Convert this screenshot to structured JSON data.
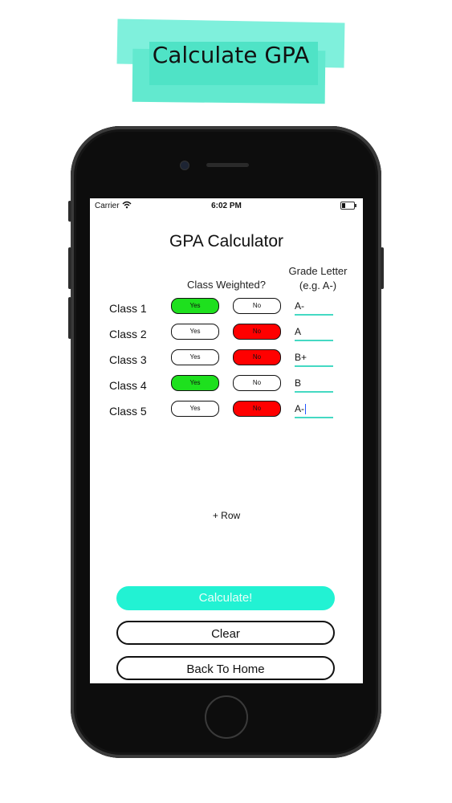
{
  "banner": {
    "title": "Calculate GPA"
  },
  "status_bar": {
    "carrier": "Carrier",
    "time": "6:02 PM"
  },
  "screen": {
    "title": "GPA Calculator",
    "weighted_header": "Class Weighted?",
    "grade_header_line1": "Grade Letter",
    "grade_header_line2": "(e.g. A-)",
    "rows": [
      {
        "label": "Class 1",
        "yes": "Yes",
        "no": "No",
        "weighted": "yes",
        "grade": "A-"
      },
      {
        "label": "Class 2",
        "yes": "Yes",
        "no": "No",
        "weighted": "no",
        "grade": "A"
      },
      {
        "label": "Class 3",
        "yes": "Yes",
        "no": "No",
        "weighted": "no",
        "grade": "B+"
      },
      {
        "label": "Class 4",
        "yes": "Yes",
        "no": "No",
        "weighted": "yes",
        "grade": "B"
      },
      {
        "label": "Class 5",
        "yes": "Yes",
        "no": "No",
        "weighted": "no",
        "grade": "A-"
      }
    ],
    "add_row_label": "+ Row",
    "calculate_label": "Calculate!",
    "clear_label": "Clear",
    "back_home_label": "Back To Home"
  },
  "colors": {
    "accent": "#22f2d3",
    "yes_selected": "#1ee01e",
    "no_selected": "#ff0000"
  }
}
